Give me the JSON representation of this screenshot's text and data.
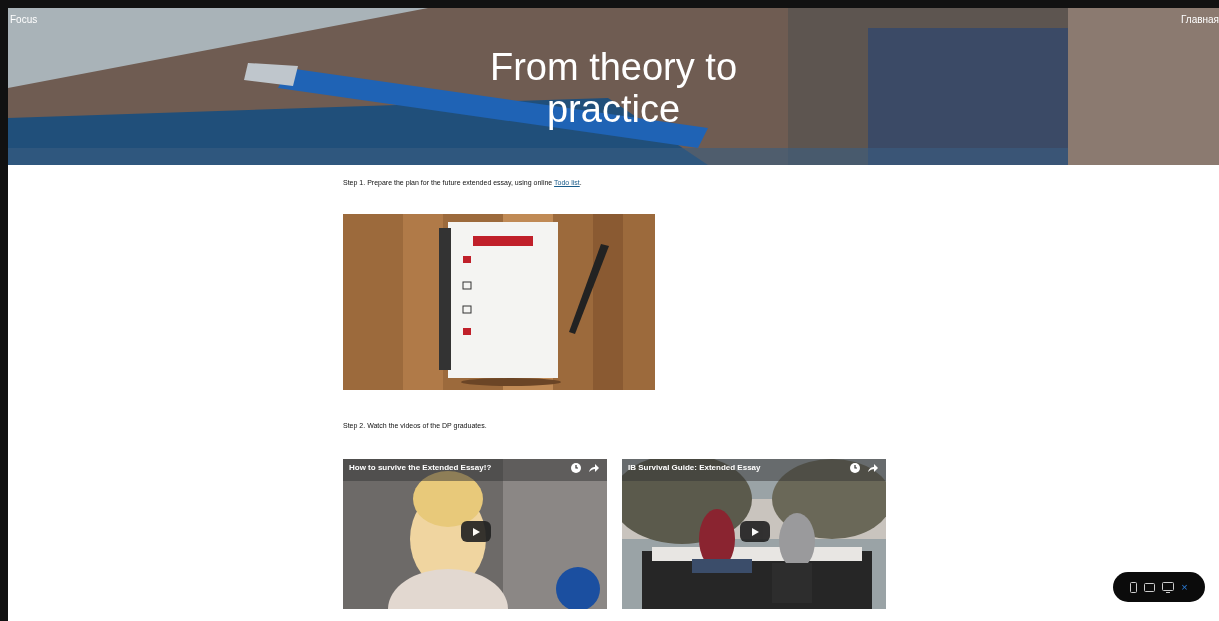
{
  "header": {
    "brand": "Focus",
    "nav_link": "Главная",
    "title": "From theory to practice"
  },
  "steps": [
    {
      "text": "Step 1.  Prepare the plan for the future extended essay, using online ",
      "link": "Todo list",
      "suffix": "."
    },
    {
      "text": "Step 2. Watch the videos of the DP graduates.",
      "videos": [
        {
          "title": "How to survive the Extended Essay!?"
        },
        {
          "title": "IB Survival Guide: Extended Essay"
        }
      ]
    }
  ],
  "device_toolbar": {
    "close": "×"
  }
}
